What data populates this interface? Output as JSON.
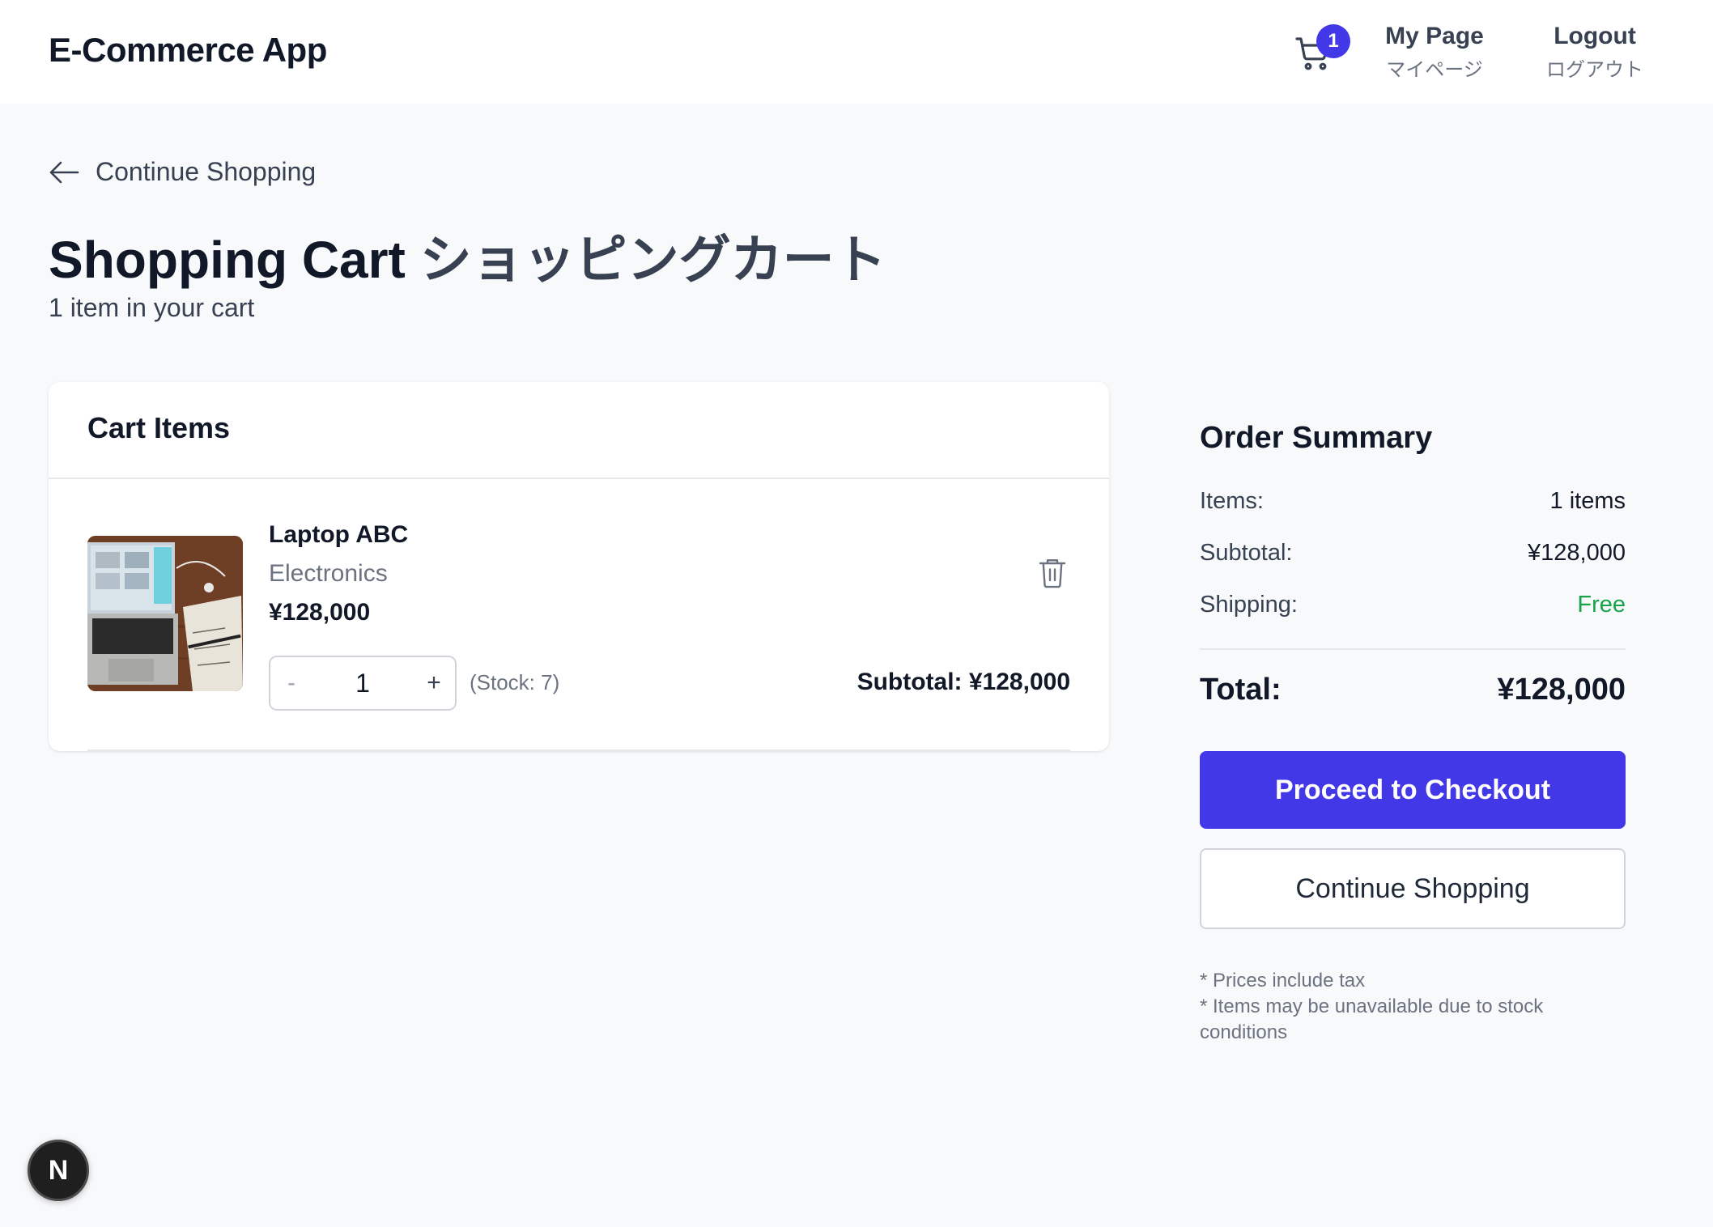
{
  "header": {
    "brand": "E-Commerce App",
    "cart_count": "1",
    "mypage_en": "My Page",
    "mypage_jp": "マイページ",
    "logout_en": "Logout",
    "logout_jp": "ログアウト"
  },
  "back_link": "Continue Shopping",
  "page": {
    "title_en": "Shopping Cart",
    "title_jp": "ショッピングカート",
    "item_count": "1 item in your cart"
  },
  "cart": {
    "heading": "Cart Items",
    "items": [
      {
        "name": "Laptop ABC",
        "category": "Electronics",
        "price": "¥128,000",
        "quantity": "1",
        "minus": "-",
        "plus": "+",
        "stock": "(Stock: 7)",
        "subtotal": "Subtotal:  ¥128,000"
      }
    ]
  },
  "summary": {
    "title": "Order Summary",
    "items_label": "Items:",
    "items_value": "1 items",
    "subtotal_label": "Subtotal:",
    "subtotal_value": "¥128,000",
    "shipping_label": "Shipping:",
    "shipping_value": "Free",
    "total_label": "Total:",
    "total_value": "¥128,000",
    "checkout_label": "Proceed to Checkout",
    "continue_label": "Continue Shopping",
    "note1": "* Prices include tax",
    "note2": "* Items may be unavailable due to stock conditions"
  },
  "dev_badge": "N",
  "colors": {
    "accent": "#4338e8",
    "free": "#16a34a",
    "background": "#f8f9fb"
  },
  "icons": [
    "cart-icon",
    "arrow-left-icon",
    "trash-icon"
  ]
}
